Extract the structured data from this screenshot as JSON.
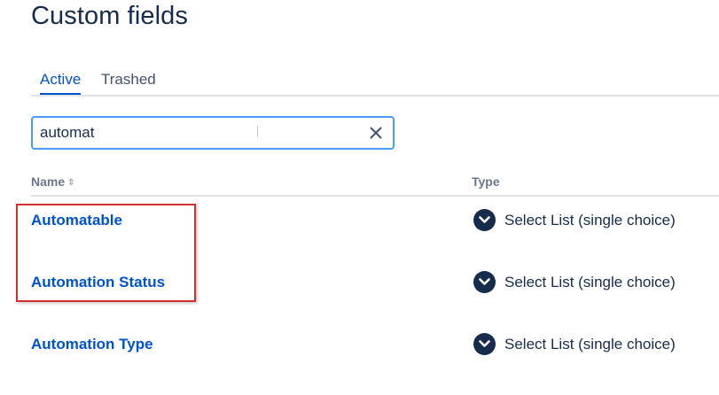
{
  "page": {
    "title": "Custom fields"
  },
  "tabs": [
    {
      "label": "Active",
      "active": true
    },
    {
      "label": "Trashed",
      "active": false
    }
  ],
  "search": {
    "value": "automat",
    "clear_icon": "close-icon"
  },
  "table": {
    "columns": [
      {
        "label": "Name",
        "sortable": true
      },
      {
        "label": "Type",
        "sortable": false
      }
    ],
    "rows": [
      {
        "name": "Automatable",
        "type": "Select List (single choice)",
        "type_icon": "chevron-down-circle-icon"
      },
      {
        "name": "Automation Status",
        "type": "Select List (single choice)",
        "type_icon": "chevron-down-circle-icon"
      },
      {
        "name": "Automation Type",
        "type": "Select List (single choice)",
        "type_icon": "chevron-down-circle-icon"
      }
    ]
  },
  "colors": {
    "link": "#0052cc",
    "text": "#172b4d",
    "highlight": "#d32f2f",
    "focus": "#4c9aff"
  }
}
